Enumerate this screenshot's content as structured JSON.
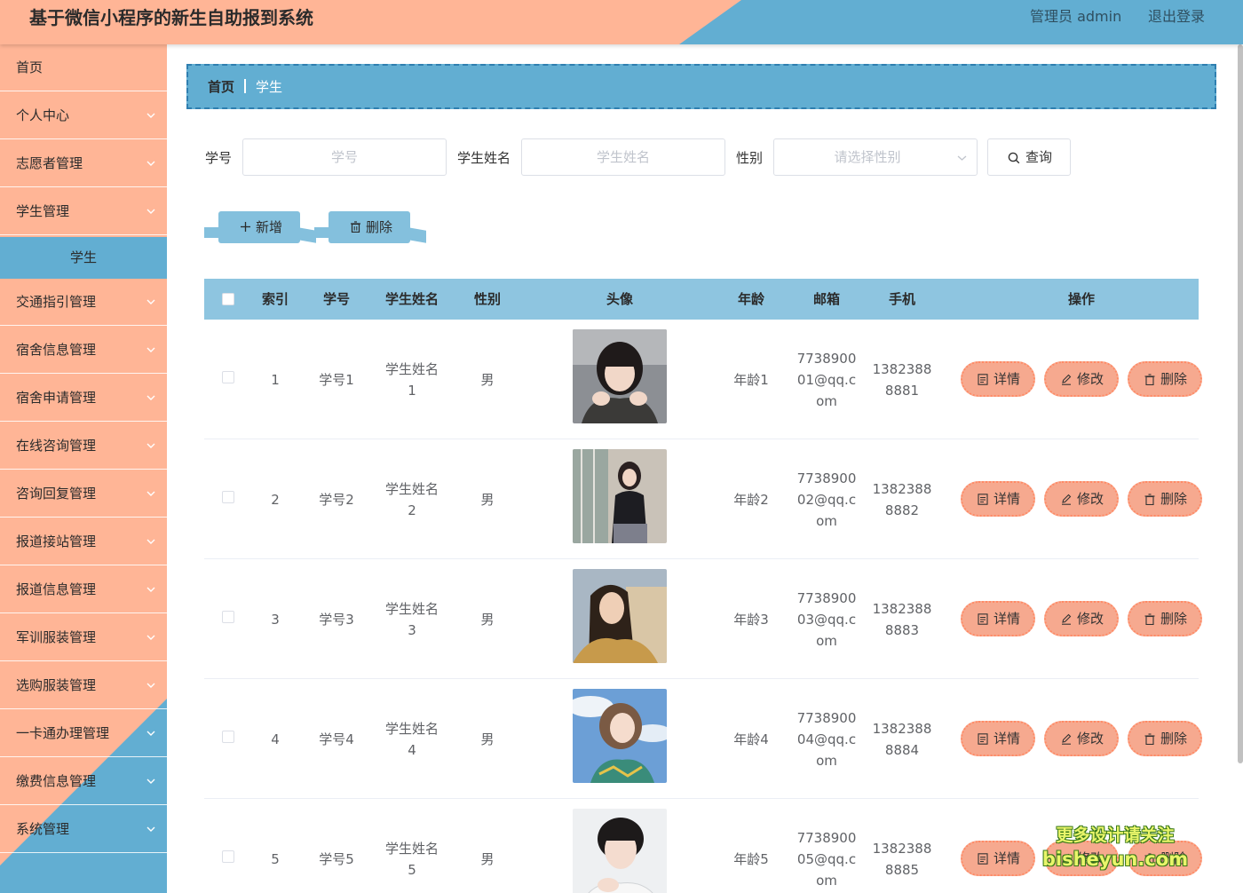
{
  "header": {
    "title": "基于微信小程序的新生自助报到系统",
    "user": "管理员 admin",
    "logout": "退出登录"
  },
  "colors": {
    "primary": "#62aed2",
    "accent": "#ffb596",
    "action_button": "#f6a98f",
    "table_header": "#8ec5e0"
  },
  "sidebar": {
    "items": [
      {
        "label": "首页",
        "has_children": false
      },
      {
        "label": "个人中心",
        "has_children": true
      },
      {
        "label": "志愿者管理",
        "has_children": true
      },
      {
        "label": "学生管理",
        "has_children": true
      },
      {
        "label": "学生",
        "is_subitem": true,
        "active": true
      },
      {
        "label": "交通指引管理",
        "has_children": true
      },
      {
        "label": "宿舍信息管理",
        "has_children": true
      },
      {
        "label": "宿舍申请管理",
        "has_children": true
      },
      {
        "label": "在线咨询管理",
        "has_children": true
      },
      {
        "label": "咨询回复管理",
        "has_children": true
      },
      {
        "label": "报道接站管理",
        "has_children": true
      },
      {
        "label": "报道信息管理",
        "has_children": true
      },
      {
        "label": "军训服装管理",
        "has_children": true
      },
      {
        "label": "选购服装管理",
        "has_children": true
      },
      {
        "label": "一卡通办理管理",
        "has_children": true
      },
      {
        "label": "缴费信息管理",
        "has_children": true
      },
      {
        "label": "系统管理",
        "has_children": true
      }
    ]
  },
  "breadcrumb": {
    "home": "首页",
    "current": "学生"
  },
  "filters": {
    "student_no": {
      "label": "学号",
      "placeholder": "学号",
      "value": ""
    },
    "student_name": {
      "label": "学生姓名",
      "placeholder": "学生姓名",
      "value": ""
    },
    "gender": {
      "label": "性别",
      "placeholder": "请选择性别"
    },
    "query_button": "查询"
  },
  "actions": {
    "add": "新增",
    "delete": "删除"
  },
  "table": {
    "columns": [
      "索引",
      "学号",
      "学生姓名",
      "性别",
      "头像",
      "年龄",
      "邮箱",
      "手机",
      "操作"
    ],
    "row_actions": {
      "detail": "详情",
      "edit": "修改",
      "delete": "删除"
    },
    "rows": [
      {
        "index": "1",
        "student_no": "学号1",
        "name_l1": "学生姓名",
        "name_l2": "1",
        "gender": "男",
        "age": "年龄1",
        "email_l1": "7738900",
        "email_l2": "01@qq.c",
        "email_l3": "om",
        "phone_l1": "1382388",
        "phone_l2": "8881",
        "avatar": "avatar-1"
      },
      {
        "index": "2",
        "student_no": "学号2",
        "name_l1": "学生姓名",
        "name_l2": "2",
        "gender": "男",
        "age": "年龄2",
        "email_l1": "7738900",
        "email_l2": "02@qq.c",
        "email_l3": "om",
        "phone_l1": "1382388",
        "phone_l2": "8882",
        "avatar": "avatar-2"
      },
      {
        "index": "3",
        "student_no": "学号3",
        "name_l1": "学生姓名",
        "name_l2": "3",
        "gender": "男",
        "age": "年龄3",
        "email_l1": "7738900",
        "email_l2": "03@qq.c",
        "email_l3": "om",
        "phone_l1": "1382388",
        "phone_l2": "8883",
        "avatar": "avatar-3"
      },
      {
        "index": "4",
        "student_no": "学号4",
        "name_l1": "学生姓名",
        "name_l2": "4",
        "gender": "男",
        "age": "年龄4",
        "email_l1": "7738900",
        "email_l2": "04@qq.c",
        "email_l3": "om",
        "phone_l1": "1382388",
        "phone_l2": "8884",
        "avatar": "avatar-4"
      },
      {
        "index": "5",
        "student_no": "学号5",
        "name_l1": "学生姓名",
        "name_l2": "5",
        "gender": "男",
        "age": "年龄5",
        "email_l1": "7738900",
        "email_l2": "05@qq.c",
        "email_l3": "om",
        "phone_l1": "1382388",
        "phone_l2": "8885",
        "avatar": "avatar-5"
      }
    ]
  },
  "watermark": {
    "line1": "更多设计请关注",
    "line2": "bisheyun.com"
  }
}
